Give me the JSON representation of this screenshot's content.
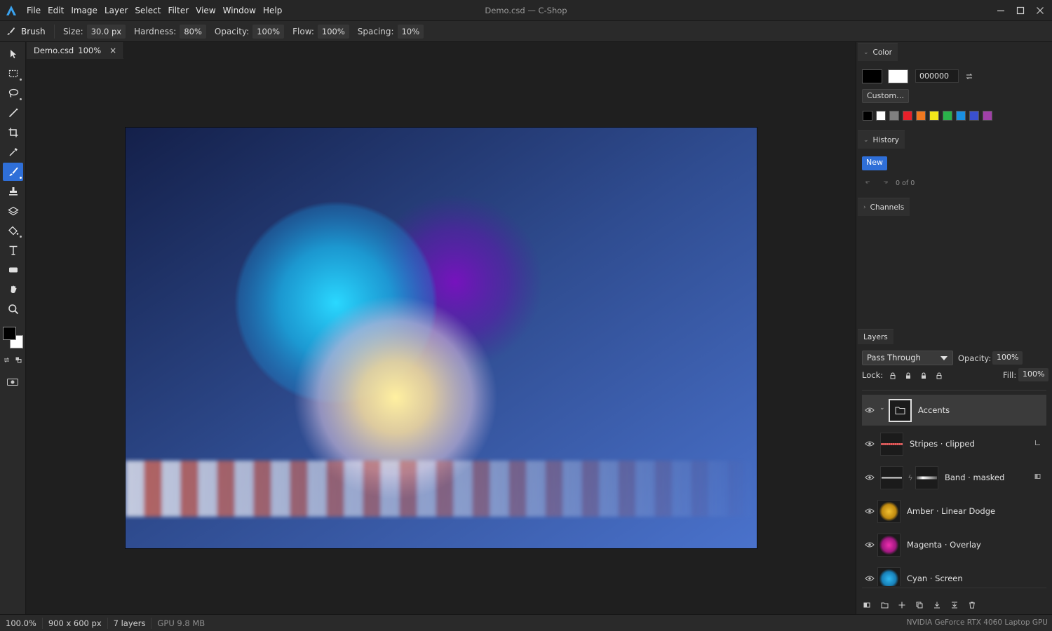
{
  "app": {
    "window_title": "Demo.csd — C-Shop",
    "menu": [
      "File",
      "Edit",
      "Image",
      "Layer",
      "Select",
      "Filter",
      "View",
      "Window",
      "Help"
    ]
  },
  "options_bar": {
    "tool_name": "Brush",
    "size": {
      "label": "Size:",
      "value": "30.0 px"
    },
    "hardness": {
      "label": "Hardness:",
      "value": "80%"
    },
    "opacity": {
      "label": "Opacity:",
      "value": "100%"
    },
    "flow": {
      "label": "Flow:",
      "value": "100%"
    },
    "spacing": {
      "label": "Spacing:",
      "value": "10%"
    }
  },
  "toolbox": {
    "tools": [
      "move",
      "marquee",
      "lasso",
      "magic-wand",
      "crop",
      "eyedropper",
      "brush",
      "stamp",
      "eraser",
      "fill",
      "type",
      "shape",
      "hand",
      "zoom"
    ],
    "active_tool": "brush",
    "foreground_color": "#000000",
    "background_color": "#ffffff"
  },
  "document": {
    "tab_name": "Demo.csd",
    "tab_zoom": "100%",
    "close_glyph": "×"
  },
  "color_panel": {
    "title": "Color",
    "hex_value": "000000",
    "custom_label": "Custom…",
    "swatches": [
      "#000000",
      "#ffffff",
      "#808080",
      "#e8202a",
      "#f07820",
      "#f4e81a",
      "#2ab24a",
      "#1a90e0",
      "#3a50d0",
      "#a040a8"
    ]
  },
  "history_panel": {
    "title": "History",
    "new_label": "New",
    "count": "0 of 0"
  },
  "channels_panel": {
    "title": "Channels"
  },
  "layers_panel": {
    "title": "Layers",
    "blend_mode": "Pass Through",
    "opacity_label": "Opacity:",
    "opacity_value": "100%",
    "lock_label": "Lock:",
    "fill_label": "Fill:",
    "fill_value": "100%",
    "layers": [
      {
        "name": "Accents",
        "type": "group",
        "selected": true
      },
      {
        "name": "Stripes · clipped",
        "type": "clipped"
      },
      {
        "name": "Band · masked",
        "type": "masked"
      },
      {
        "name": "Amber · Linear Dodge",
        "type": "pixel",
        "color": "#e0a020"
      },
      {
        "name": "Magenta · Overlay",
        "type": "pixel",
        "color": "#e0209a"
      },
      {
        "name": "Cyan · Screen",
        "type": "pixel",
        "color": "#20a8e8"
      }
    ]
  },
  "status_bar": {
    "zoom": "100.0%",
    "dimensions": "900 x 600 px",
    "layers": "7 layers",
    "gpu_memory": "GPU 9.8 MB",
    "device": "NVIDIA GeForce RTX 4060 Laptop GPU"
  }
}
